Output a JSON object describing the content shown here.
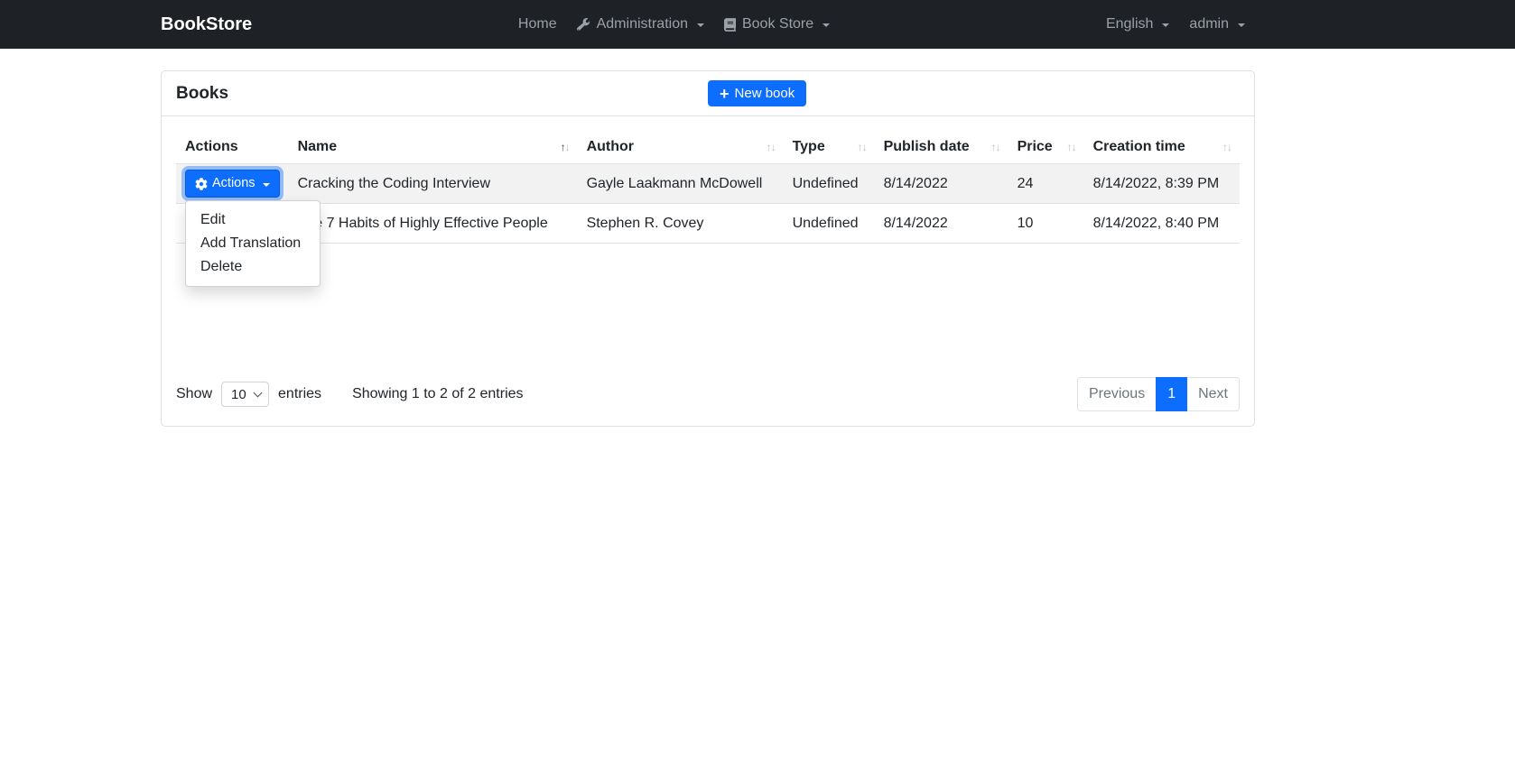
{
  "colors": {
    "primary": "#0d6efd",
    "navbar_bg": "#1e2125",
    "navbar_fg": "#9ba1a6",
    "border": "#dee2e6",
    "stripe": "#f2f2f2",
    "muted": "#6c757d"
  },
  "navbar": {
    "brand": "BookStore",
    "items": [
      {
        "label": "Home",
        "icon": null
      },
      {
        "label": "Administration",
        "icon": "wrench-icon",
        "caret": true
      },
      {
        "label": "Book Store",
        "icon": "book-icon",
        "caret": true
      }
    ],
    "right_items": [
      {
        "label": "English",
        "icon": "caret-down-icon"
      },
      {
        "label": "admin",
        "icon": "caret-down-icon"
      }
    ]
  },
  "page": {
    "title": "Books",
    "new_book_label": "New book",
    "new_book_icon": "plus-icon"
  },
  "table": {
    "columns": [
      {
        "label": "Actions",
        "sortable": false
      },
      {
        "label": "Name",
        "sortable": true,
        "sorted": "asc"
      },
      {
        "label": "Author",
        "sortable": true
      },
      {
        "label": "Type",
        "sortable": true
      },
      {
        "label": "Publish date",
        "sortable": true
      },
      {
        "label": "Price",
        "sortable": true
      },
      {
        "label": "Creation time",
        "sortable": true
      }
    ],
    "actions_button": {
      "label": "Actions",
      "icon": "gear-icon"
    },
    "rows": [
      {
        "name": "Cracking the Coding Interview",
        "author": "Gayle Laakmann McDowell",
        "type": "Undefined",
        "publish_date": "8/14/2022",
        "price": "24",
        "creation_time": "8/14/2022, 8:39 PM"
      },
      {
        "name": "The 7 Habits of Highly Effective People",
        "author": "Stephen R. Covey",
        "type": "Undefined",
        "publish_date": "8/14/2022",
        "price": "10",
        "creation_time": "8/14/2022, 8:40 PM"
      }
    ]
  },
  "dropdown": {
    "items": [
      "Edit",
      "Add Translation",
      "Delete"
    ]
  },
  "footer": {
    "show_label": "Show",
    "page_size": "10",
    "entries_label": "entries",
    "summary": "Showing 1 to 2 of 2 entries",
    "pagination": {
      "previous": "Previous",
      "current_page": "1",
      "next": "Next"
    }
  }
}
